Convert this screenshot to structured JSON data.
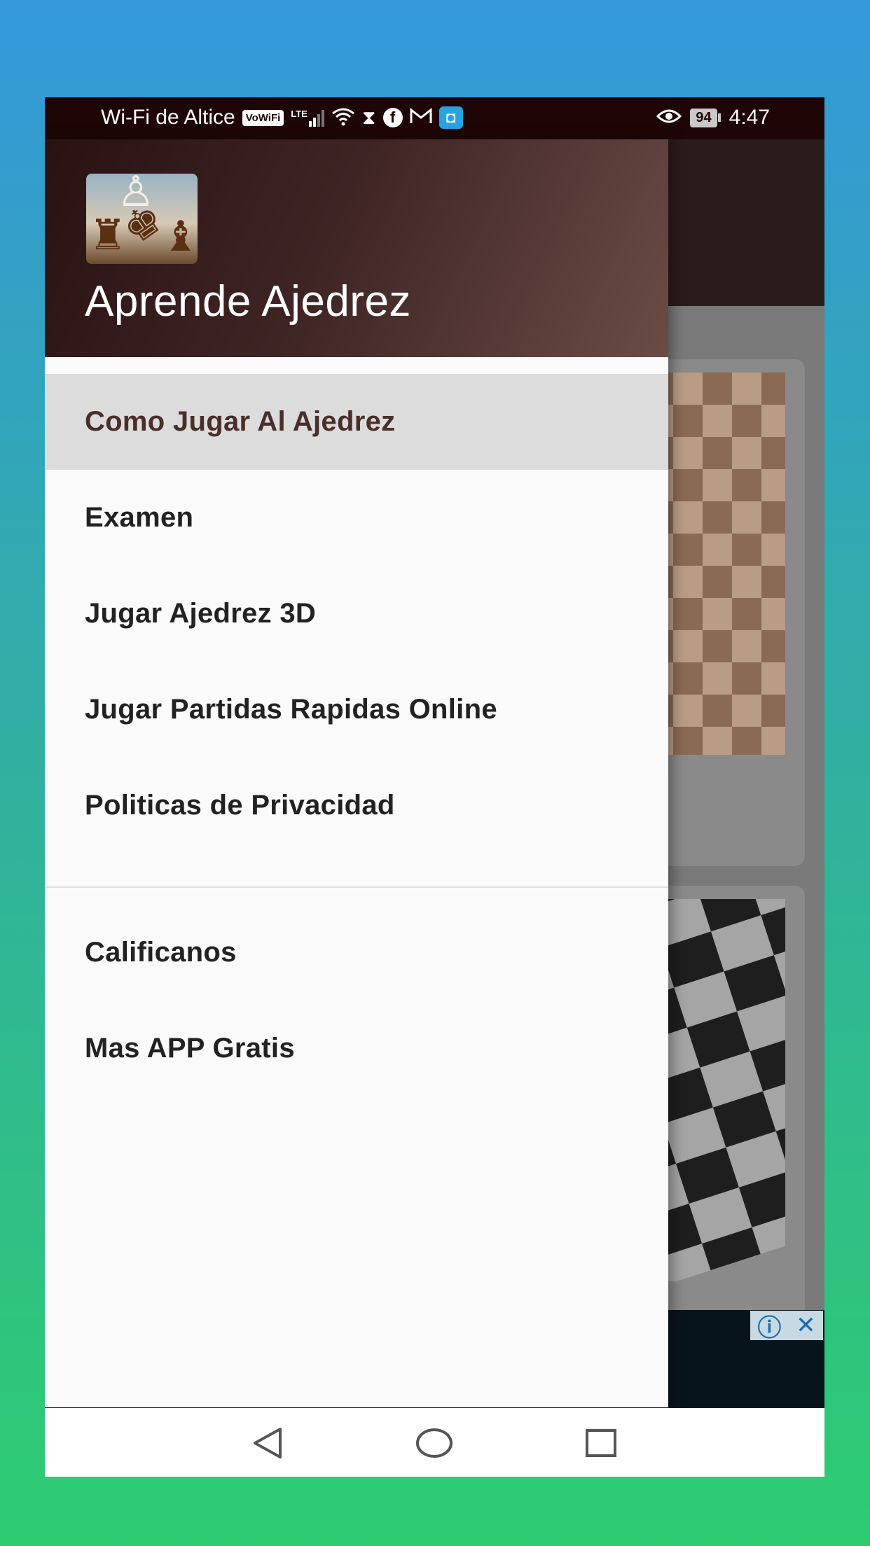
{
  "status_bar": {
    "carrier": "Wi-Fi de Altice",
    "vowifi": "VoWiFi",
    "lte": "LTE",
    "battery": "94",
    "time": "4:47",
    "icons": [
      "signal-icon",
      "wifi-icon",
      "hourglass-icon",
      "facebook-icon",
      "gmail-icon",
      "app-icon",
      "eye-icon"
    ]
  },
  "drawer": {
    "title": "Aprende Ajedrez",
    "items": [
      {
        "label": "Como Jugar Al Ajedrez",
        "selected": true
      },
      {
        "label": "Examen"
      },
      {
        "label": "Jugar Ajedrez 3D"
      },
      {
        "label": "Jugar Partidas Rapidas Online"
      },
      {
        "label": "Politicas de Privacidad"
      }
    ],
    "secondary_items": [
      {
        "label": "Calificanos"
      },
      {
        "label": "Mas APP Gratis"
      }
    ]
  },
  "ad": {
    "info_symbol": "ⓘ",
    "close_symbol": "✕"
  },
  "colors": {
    "header_dark": "#2a1212",
    "header_light": "#6a4c46",
    "selected_bg": "#dcdcdc",
    "selected_text": "#4a2e2a"
  }
}
